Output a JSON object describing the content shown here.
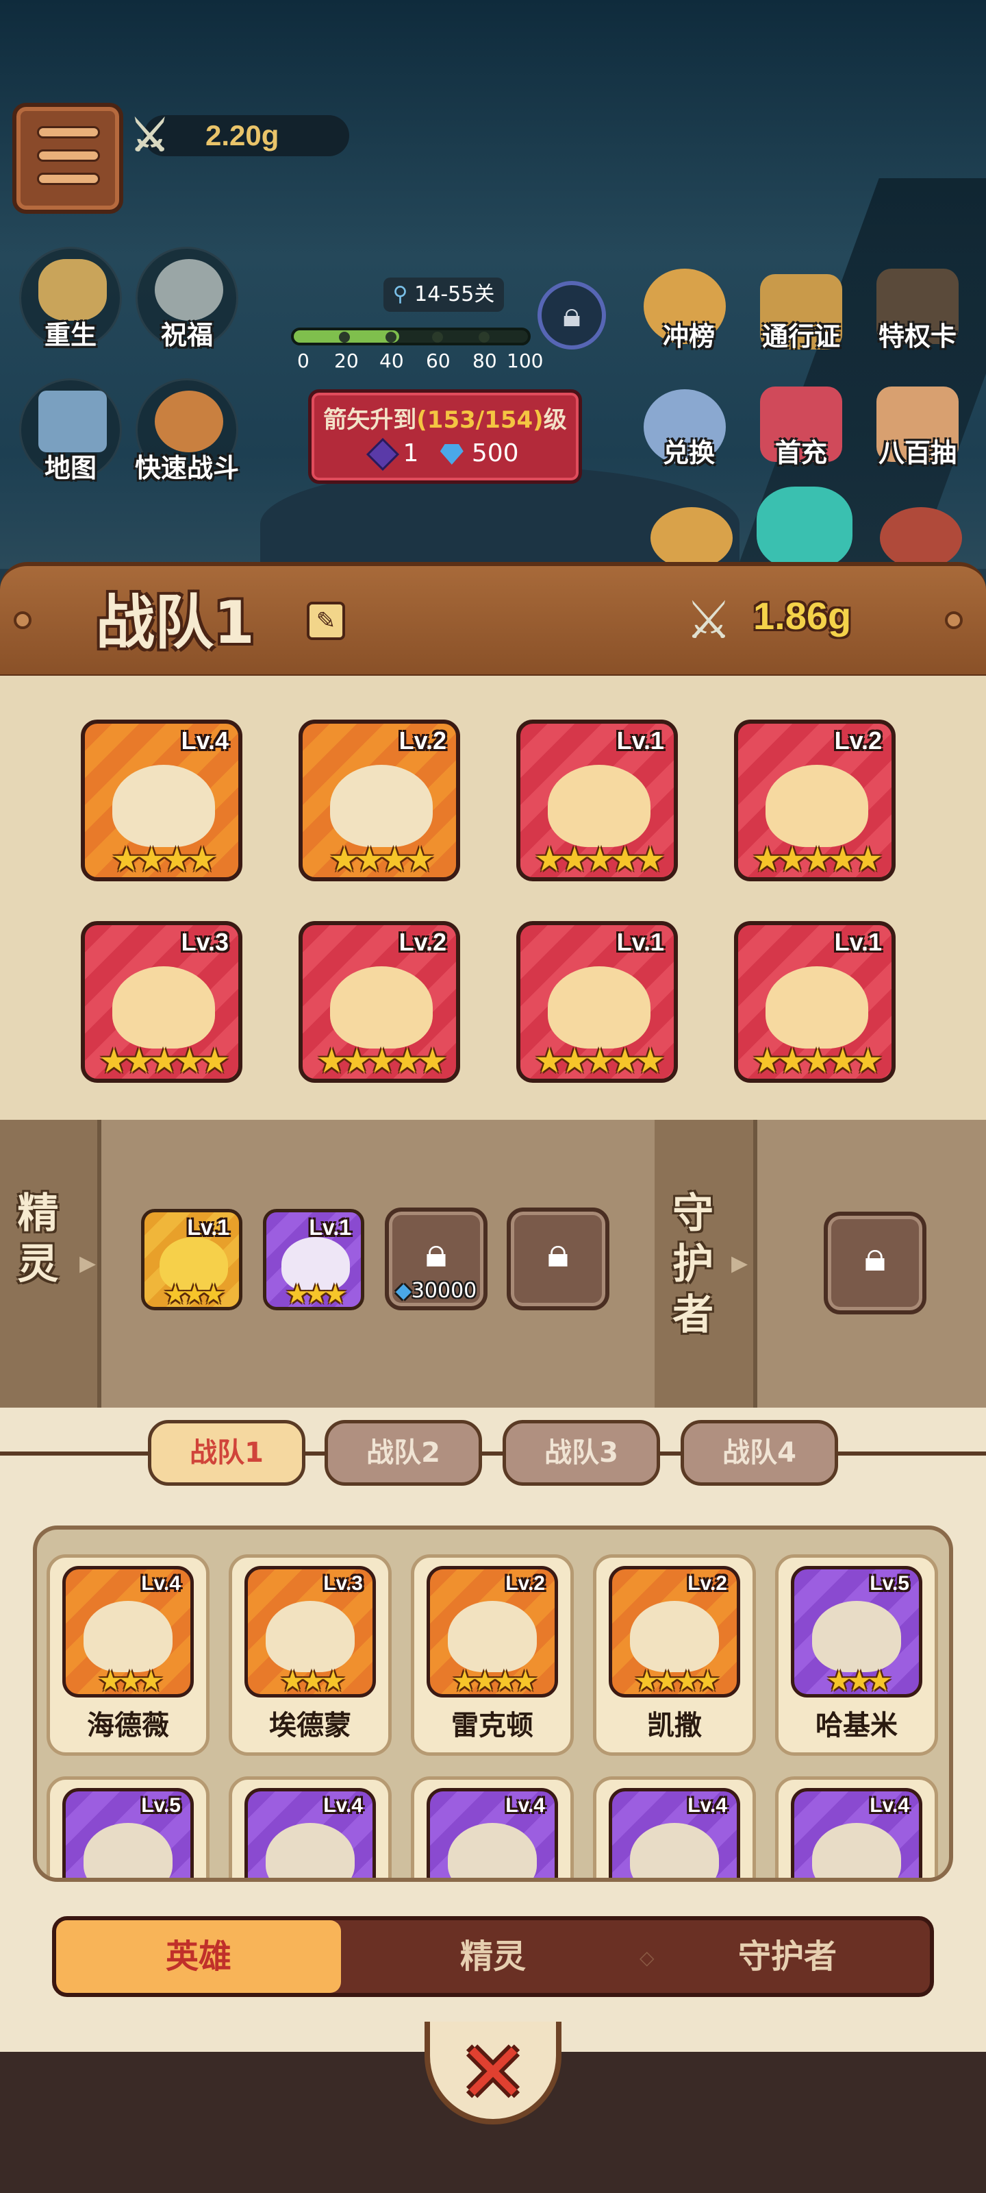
{
  "top": {
    "power": "2.20g",
    "left_buttons": [
      {
        "label": "重生",
        "icon": "rebirth-icon"
      },
      {
        "label": "祝福",
        "icon": "blessing-icon"
      },
      {
        "label": "地图",
        "icon": "map-icon"
      },
      {
        "label": "快速战斗",
        "icon": "quick-battle-icon"
      }
    ],
    "stage": "14-55关",
    "progress_ticks": [
      "0",
      "20",
      "40",
      "60",
      "80",
      "100"
    ],
    "progress_value": 0.45,
    "arrow_upgrade": {
      "prefix": "箭矢升到",
      "level": "(153/154)",
      "suffix": "级",
      "cost_purple": "1",
      "cost_gem": "500"
    },
    "right_buttons": [
      {
        "label": "冲榜",
        "icon": "rank-icon"
      },
      {
        "label": "通行证",
        "icon": "pass-icon"
      },
      {
        "label": "特权卡",
        "icon": "privilege-card-icon"
      },
      {
        "label": "兑换",
        "icon": "exchange-icon"
      },
      {
        "label": "首充",
        "icon": "first-recharge-icon"
      },
      {
        "label": "八百抽",
        "icon": "eight-hundred-draw-icon"
      }
    ]
  },
  "team": {
    "name": "战队1",
    "power": "1.86g",
    "slots": [
      {
        "level": "Lv.4",
        "stars": 4,
        "color": "orange"
      },
      {
        "level": "Lv.2",
        "stars": 4,
        "color": "orange"
      },
      {
        "level": "Lv.1",
        "stars": 5,
        "color": "red"
      },
      {
        "level": "Lv.2",
        "stars": 5,
        "color": "red"
      },
      {
        "level": "Lv.3",
        "stars": 5,
        "color": "red"
      },
      {
        "level": "Lv.2",
        "stars": 5,
        "color": "red"
      },
      {
        "level": "Lv.1",
        "stars": 5,
        "color": "red"
      },
      {
        "level": "Lv.1",
        "stars": 5,
        "color": "red"
      }
    ]
  },
  "sprites": {
    "label": "精灵",
    "items": [
      {
        "level": "Lv.1",
        "stars": 3
      },
      {
        "level": "Lv.1",
        "stars": 3
      }
    ],
    "locked_cost": "30000"
  },
  "guardian": {
    "label": "守护者"
  },
  "team_tabs": [
    "战队1",
    "战队2",
    "战队3",
    "战队4"
  ],
  "roster": [
    {
      "name": "海德薇",
      "level": "Lv.4",
      "stars": 3,
      "color": "orange"
    },
    {
      "name": "埃德蒙",
      "level": "Lv.3",
      "stars": 3,
      "color": "orange"
    },
    {
      "name": "雷克顿",
      "level": "Lv.2",
      "stars": 4,
      "color": "orange"
    },
    {
      "name": "凯撒",
      "level": "Lv.2",
      "stars": 4,
      "color": "orange"
    },
    {
      "name": "哈基米",
      "level": "Lv.5",
      "stars": 3,
      "color": "purple"
    },
    {
      "name": "",
      "level": "Lv.5",
      "stars": 0,
      "color": "purple"
    },
    {
      "name": "",
      "level": "Lv.4",
      "stars": 0,
      "color": "purple"
    },
    {
      "name": "",
      "level": "Lv.4",
      "stars": 0,
      "color": "purple"
    },
    {
      "name": "",
      "level": "Lv.4",
      "stars": 0,
      "color": "purple"
    },
    {
      "name": "",
      "level": "Lv.4",
      "stars": 0,
      "color": "purple"
    }
  ],
  "categories": [
    "英雄",
    "精灵",
    "守护者"
  ]
}
